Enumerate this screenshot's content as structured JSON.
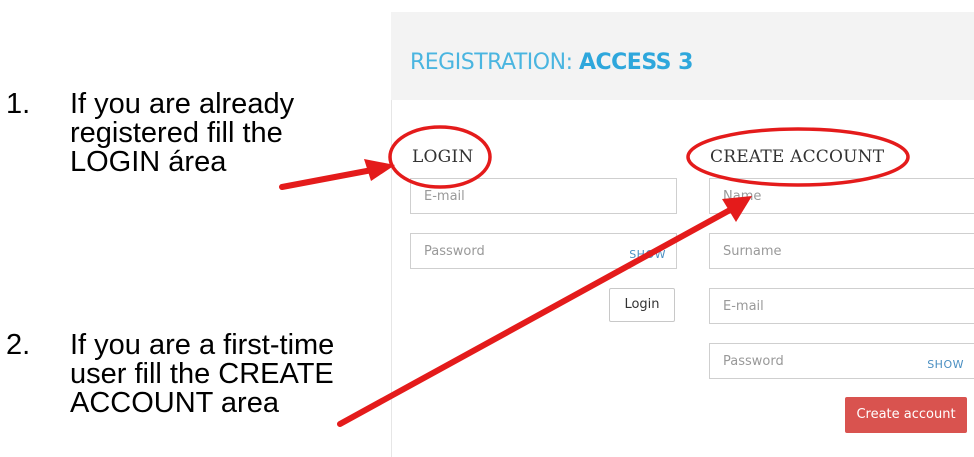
{
  "instructions": [
    {
      "number": "1.",
      "lines": [
        "If you are already",
        "registered fill the",
        "LOGIN área"
      ]
    },
    {
      "number": "2.",
      "lines": [
        "If you are a first-time",
        "user fill the CREATE",
        "ACCOUNT area"
      ]
    }
  ],
  "panel": {
    "title_lead": "REGISTRATION: ",
    "title_bold": "ACCESS 3"
  },
  "login": {
    "label": "LOGIN",
    "email_placeholder": "E-mail",
    "password_placeholder": "Password",
    "show_label": "SHOW",
    "button_label": "Login"
  },
  "create_account": {
    "label": "CREATE ACCOUNT",
    "name_placeholder": "Name",
    "surname_placeholder": "Surname",
    "email_placeholder": "E-mail",
    "password_placeholder": "Password",
    "show_label": "SHOW",
    "button_label": "Create account"
  },
  "colors": {
    "annotation": "#e41b1b",
    "accent": "#2ea7dc",
    "create_button": "#d9534f"
  }
}
